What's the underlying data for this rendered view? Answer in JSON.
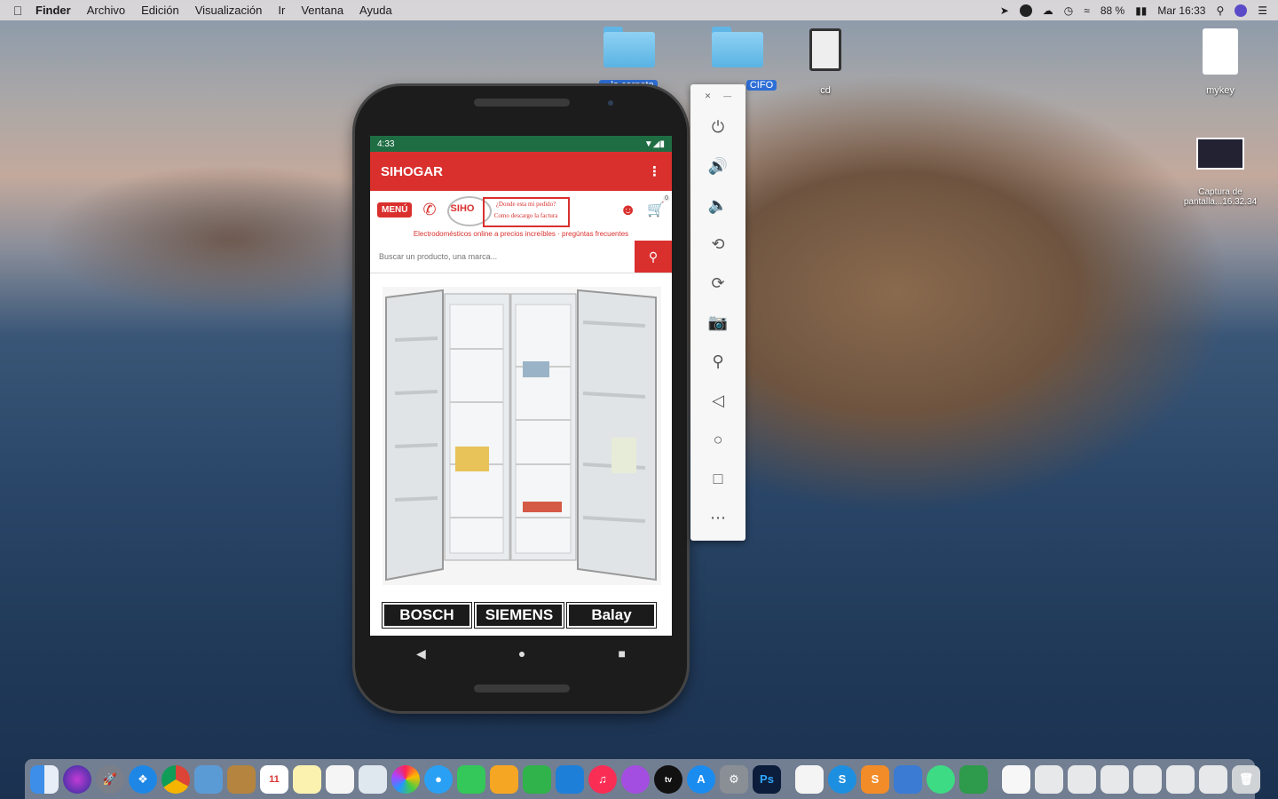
{
  "menubar": {
    "app": "Finder",
    "menus": [
      "Archivo",
      "Edición",
      "Visualización",
      "Ir",
      "Ventana",
      "Ayuda"
    ],
    "battery": "88 %",
    "clock": "Mar 16:33"
  },
  "desktop": {
    "icons": [
      {
        "label": "...la carpeta",
        "selected": true,
        "kind": "folder"
      },
      {
        "label": "CIFO",
        "selected": true,
        "kind": "folder"
      },
      {
        "label": "cd",
        "selected": false,
        "kind": "document"
      },
      {
        "label": "mykey",
        "selected": false,
        "kind": "document"
      },
      {
        "label": "Captura de pantalla...16.32.34",
        "selected": false,
        "kind": "screenshot"
      }
    ]
  },
  "phone": {
    "status_time": "4:33",
    "app_title": "SIHOGAR",
    "menu_badge": "MENÚ",
    "logo_text": "SIHO",
    "logo_box_line1": "¿Donde esta mi pedido?",
    "logo_box_line2": "Como descargo la factura",
    "cart_count": "0",
    "tagline": "Electrodomésticos online a precios increíbles · pregúntas frecuentes",
    "search_placeholder": "Buscar un producto, una marca...",
    "brands": [
      "BOSCH",
      "SIEMENS",
      "Balay"
    ]
  },
  "emulator_panel": {
    "controls": [
      "power",
      "volume-up",
      "volume-down",
      "rotate-left",
      "rotate-right",
      "screenshot",
      "zoom",
      "back",
      "home",
      "overview",
      "more"
    ]
  },
  "dock": {
    "apps": [
      "Finder",
      "Siri",
      "Launchpad",
      "Safari",
      "Chrome",
      "Preview",
      "Notes",
      "Calendar",
      "Stickies",
      "TextEdit",
      "Photos",
      "Photos Booth",
      "Messages",
      "FaceTime",
      "Pages",
      "Numbers",
      "Keynote",
      "Music",
      "Podcasts",
      "TV",
      "App Store",
      "System Preferences",
      "Photoshop"
    ],
    "calendar_day": "11"
  }
}
